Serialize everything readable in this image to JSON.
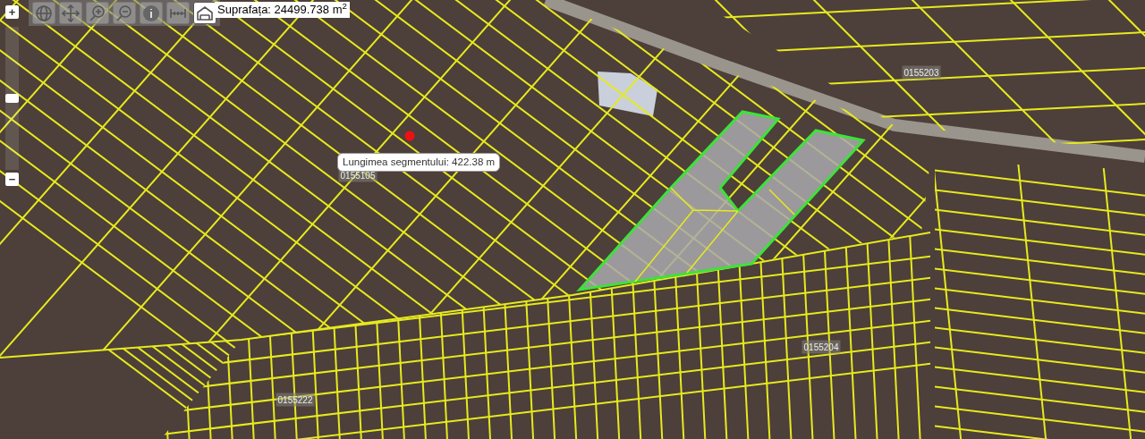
{
  "zoom_control": {
    "zoom_in": "+",
    "zoom_out": "−",
    "level": 0.5
  },
  "toolbar": {
    "tools": [
      {
        "kind": "globe",
        "selected": false
      },
      {
        "kind": "pan",
        "selected": false
      },
      {
        "kind": "zoom-in",
        "selected": false
      },
      {
        "kind": "zoom-out",
        "selected": false
      },
      {
        "kind": "info",
        "selected": false
      },
      {
        "kind": "measure-length",
        "selected": false
      },
      {
        "kind": "measure-area",
        "selected": true
      }
    ]
  },
  "area_readout": "Suprafața: 24499.738 m$^{2}$",
  "measure_tooltip": "Lungimea segmentului: 422.38 m",
  "parcel_labels": [
    {
      "text": "0155105"
    },
    {
      "text": "0155203"
    },
    {
      "text": "0155204"
    },
    {
      "text": "0155222"
    }
  ]
}
